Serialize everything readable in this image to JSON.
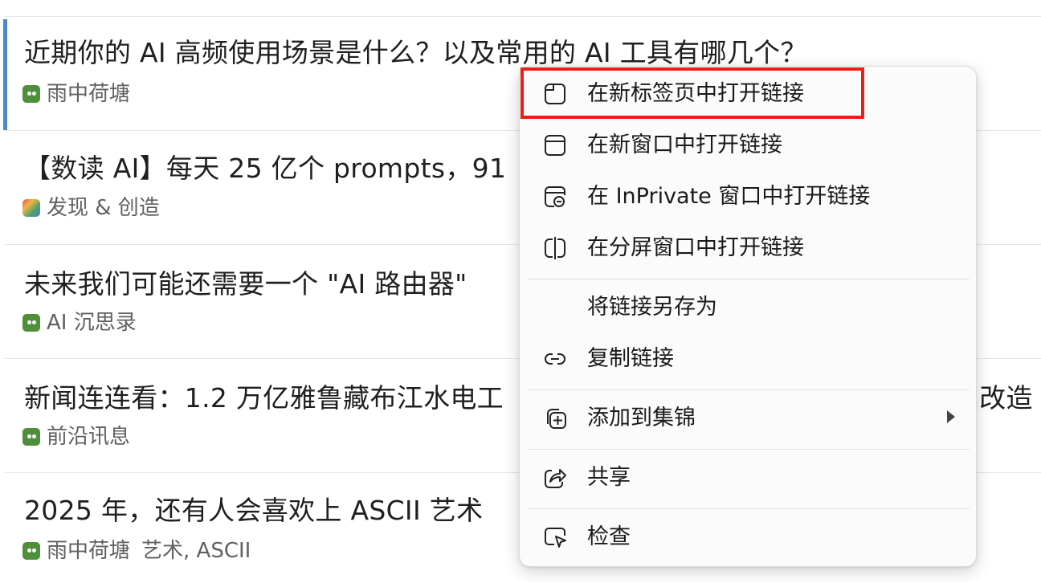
{
  "topics": [
    {
      "title": "近期你的 AI 高频使用场景是什么？以及常用的 AI 工具有哪几个？",
      "category": "雨中荷塘",
      "tags": "",
      "avatar": "green"
    },
    {
      "title": "【数读 AI】每天 25 亿个 prompts，91",
      "category": "发现 & 创造",
      "tags": "",
      "avatar": "multi"
    },
    {
      "title": "未来我们可能还需要一个 \"AI 路由器\"",
      "category": "AI 沉思录",
      "tags": "",
      "avatar": "green"
    },
    {
      "title": "新闻连连看：1.2 万亿雅鲁藏布江水电工",
      "title_tail": "]改造",
      "category": "前沿讯息",
      "tags": "",
      "avatar": "green"
    },
    {
      "title": "2025 年，还有人会喜欢上 ASCII 艺术",
      "category": "雨中荷塘",
      "tags": "艺术, ASCII",
      "avatar": "green"
    }
  ],
  "context_menu": {
    "items": [
      {
        "label": "在新标签页中打开链接",
        "icon": "new-tab-icon"
      },
      {
        "label": "在新窗口中打开链接",
        "icon": "new-window-icon"
      },
      {
        "label": "在 InPrivate 窗口中打开链接",
        "icon": "inprivate-window-icon"
      },
      {
        "label": "在分屏窗口中打开链接",
        "icon": "split-screen-icon"
      },
      {
        "label": "将链接另存为",
        "icon": ""
      },
      {
        "label": "复制链接",
        "icon": "link-icon"
      },
      {
        "label": "添加到集锦",
        "icon": "collections-add-icon"
      },
      {
        "label": "共享",
        "icon": "share-icon"
      },
      {
        "label": "检查",
        "icon": "inspect-icon"
      }
    ]
  },
  "colors": {
    "accent_bar": "#4a88c9",
    "highlight": "#e62117"
  }
}
